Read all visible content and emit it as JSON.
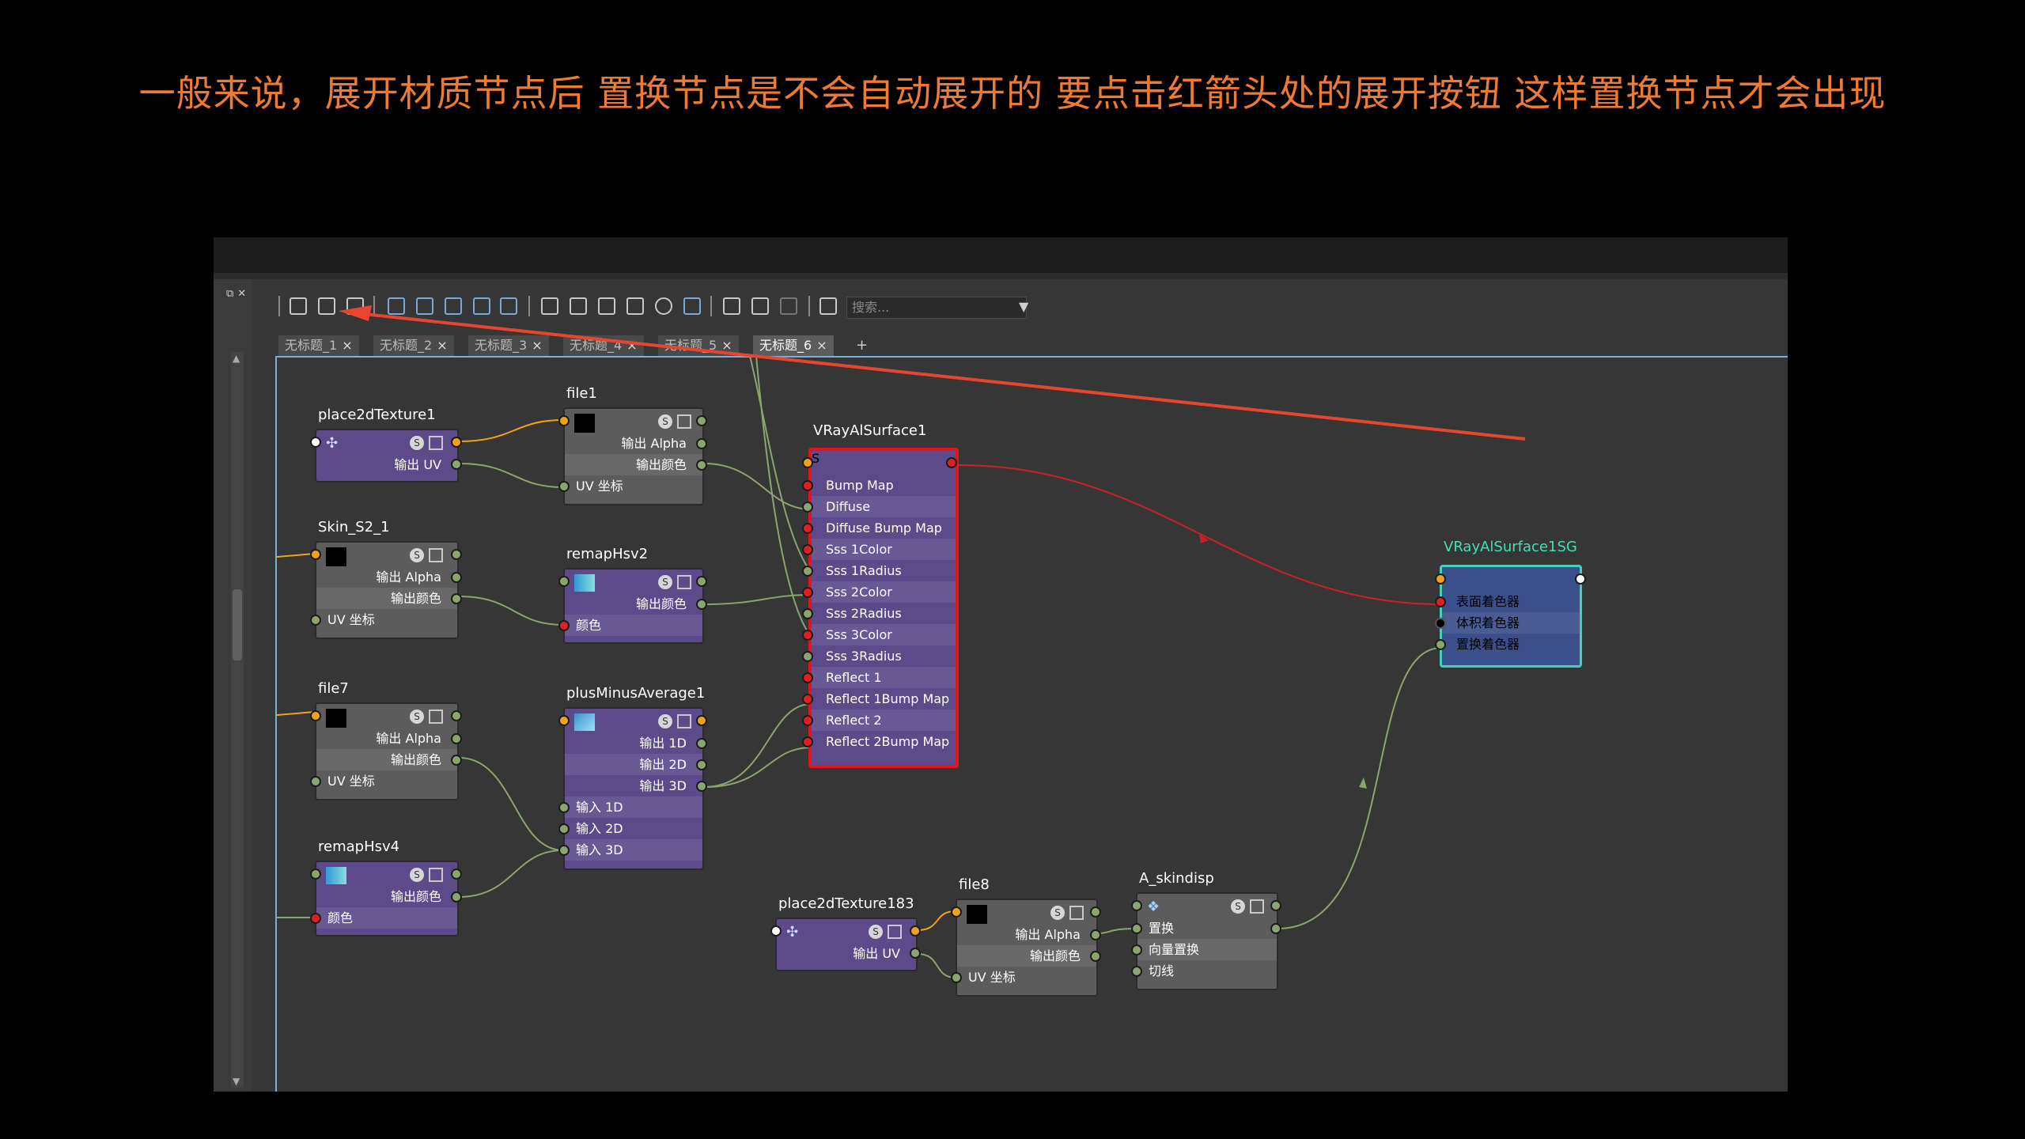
{
  "caption": "一般来说，展开材质节点后 置换节点是不会自动展开的 要点击红箭头处的展开按钮 这样置换节点才会出现",
  "toolbar": {
    "search_placeholder": "搜索..."
  },
  "tabs": [
    {
      "label": "无标题_1"
    },
    {
      "label": "无标题_2"
    },
    {
      "label": "无标题_3"
    },
    {
      "label": "无标题_4"
    },
    {
      "label": "无标题_5"
    },
    {
      "label": "无标题_6",
      "active": true
    }
  ],
  "tab_add": "+",
  "tab_close": "×",
  "swatch_btn": "S",
  "colors": {
    "annotation_arrow": "#e8452f",
    "wire_red": "#c8202a",
    "wire_green": "#8aa56d",
    "wire_orange": "#f2a21a",
    "sg_border": "#45cfbd"
  },
  "nodes": {
    "place2dTexture1": {
      "title": "place2dTexture1",
      "out_uv": "输出 UV"
    },
    "file1": {
      "title": "file1",
      "out_alpha": "输出 Alpha",
      "out_color": "输出颜色",
      "uv": "UV 坐标"
    },
    "skin_s2_1": {
      "title": "Skin_S2_1",
      "out_alpha": "输出 Alpha",
      "out_color": "输出颜色",
      "uv": "UV 坐标"
    },
    "remapHsv2": {
      "title": "remapHsv2",
      "out_color": "输出颜色",
      "color": "颜色"
    },
    "file7": {
      "title": "file7",
      "out_alpha": "输出 Alpha",
      "out_color": "输出颜色",
      "uv": "UV 坐标"
    },
    "plusMinusAverage1": {
      "title": "plusMinusAverage1",
      "out_1d": "输出 1D",
      "out_2d": "输出 2D",
      "out_3d": "输出 3D",
      "in_1d": "输入 1D",
      "in_2d": "输入 2D",
      "in_3d": "输入 3D"
    },
    "remapHsv4": {
      "title": "remapHsv4",
      "out_color": "输出颜色",
      "color": "颜色"
    },
    "place2dTexture183": {
      "title": "place2dTexture183",
      "out_uv": "输出 UV"
    },
    "file8": {
      "title": "file8",
      "out_alpha": "输出 Alpha",
      "out_color": "输出颜色",
      "uv": "UV 坐标"
    },
    "a_skindisp": {
      "title": "A_skindisp",
      "disp": "置换",
      "vector_disp": "向量置换",
      "tangent": "切线"
    },
    "vray": {
      "title": "VRayAlSurface1",
      "attrs": [
        "Bump Map",
        "Diffuse",
        "Diffuse Bump Map",
        "Sss 1Color",
        "Sss 1Radius",
        "Sss 2Color",
        "Sss 2Radius",
        "Sss 3Color",
        "Sss 3Radius",
        "Reflect 1",
        "Reflect 1Bump Map",
        "Reflect 2",
        "Reflect 2Bump Map"
      ]
    },
    "sg": {
      "title": "VRayAlSurface1SG",
      "surface": "表面着色器",
      "volume": "体积着色器",
      "disp": "置换着色器"
    }
  }
}
